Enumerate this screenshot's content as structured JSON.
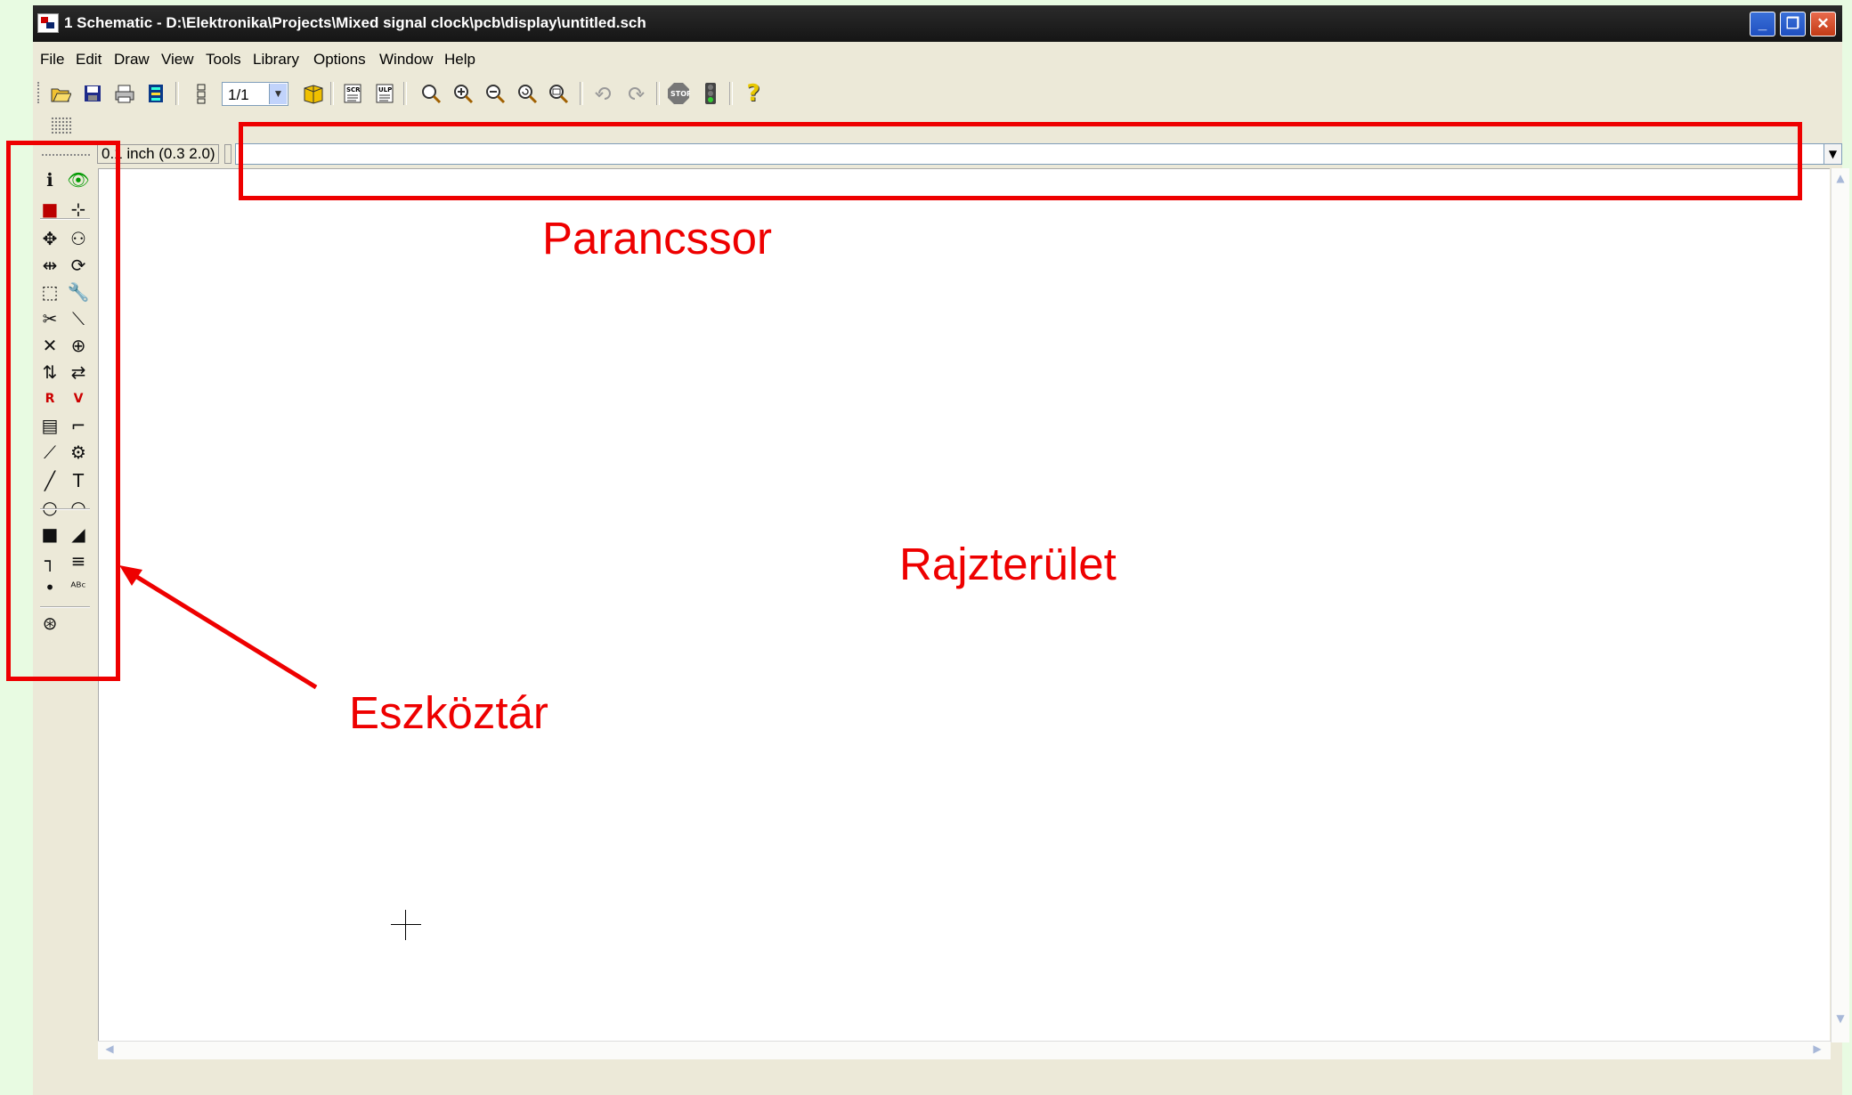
{
  "window": {
    "title": "1 Schematic - D:\\Elektronika\\Projects\\Mixed signal clock\\pcb\\display\\untitled.sch",
    "min_glyph": "_",
    "max_glyph": "❐",
    "close_glyph": "✕"
  },
  "menu": [
    "File",
    "Edit",
    "Draw",
    "View",
    "Tools",
    "Library",
    "Options",
    "Window",
    "Help"
  ],
  "toolbar": {
    "sheet_value": "1/1",
    "icons": [
      "open-icon",
      "save-icon",
      "print-icon",
      "cam-processor-icon",
      "sheet-icon",
      "board-switch-icon",
      "script-icon",
      "ulp-icon",
      "zoom-fit-icon",
      "zoom-in-icon",
      "zoom-out-icon",
      "zoom-redraw-icon",
      "zoom-select-icon",
      "undo-icon",
      "redo-icon",
      "stop-icon",
      "go-icon",
      "help-icon"
    ]
  },
  "status": {
    "grid": "0.1 inch (0.3 2.0)",
    "command": ""
  },
  "tools": [
    [
      "info-icon",
      "show-icon"
    ],
    [
      "display-layers-icon",
      "mark-icon"
    ],
    [
      "move-icon",
      "copy-icon"
    ],
    [
      "mirror-icon",
      "rotate-icon"
    ],
    [
      "group-icon",
      "change-icon"
    ],
    [
      "cut-icon",
      "paste-icon"
    ],
    [
      "delete-icon",
      "add-icon"
    ],
    [
      "pinswap-icon",
      "gateswap-icon"
    ],
    [
      "name-icon",
      "value-icon"
    ],
    [
      "smash-icon",
      "miter-icon"
    ],
    [
      "split-icon",
      "invoke-icon"
    ],
    [
      "wire-icon",
      "text-icon"
    ],
    [
      "circle-icon",
      "arc-icon"
    ],
    [
      "rect-icon",
      "polygon-icon"
    ],
    [
      "bus-icon",
      "net-icon"
    ],
    [
      "junction-icon",
      "label-icon"
    ],
    [
      "erc-icon"
    ]
  ],
  "annotations": {
    "command_line": "Parancssor",
    "drawing_area": "Rajzterület",
    "toolbar": "Eszköztár"
  },
  "colors": {
    "annotation": "#ee0000",
    "title_bar": "#1e1e1e",
    "background": "#e8fbe2"
  }
}
